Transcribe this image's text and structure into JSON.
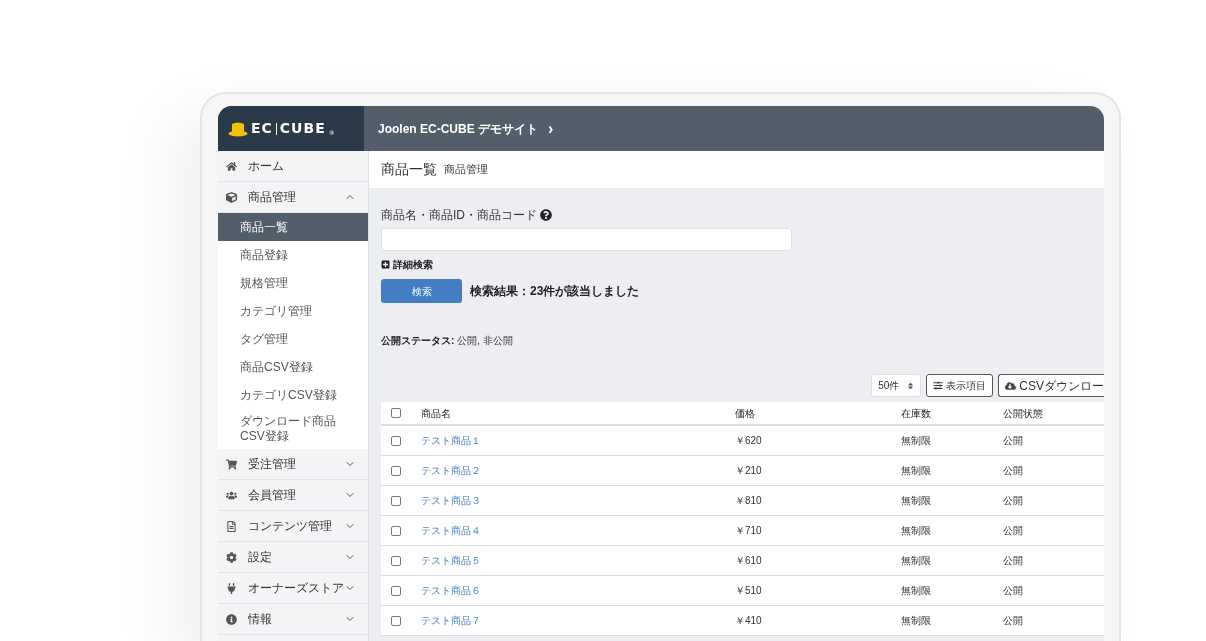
{
  "header": {
    "logo": {
      "left": "EC",
      "right": "CUBE",
      "mark": "®"
    },
    "site_title": "Joolen EC-CUBE デモサイト",
    "site_arrow": "›"
  },
  "sidebar": {
    "items": [
      {
        "label": "ホーム",
        "kind": "link"
      },
      {
        "label": "商品管理",
        "kind": "section",
        "expanded": true,
        "children": [
          {
            "label": "商品一覧",
            "selected": true
          },
          {
            "label": "商品登録",
            "selected": false
          },
          {
            "label": "規格管理",
            "selected": false
          },
          {
            "label": "カテゴリ管理",
            "selected": false
          },
          {
            "label": "タグ管理",
            "selected": false
          },
          {
            "label": "商品CSV登録",
            "selected": false
          },
          {
            "label": "カテゴリCSV登録",
            "selected": false
          },
          {
            "label": "ダウンロード商品CSV登録",
            "selected": false
          }
        ]
      },
      {
        "label": "受注管理",
        "kind": "section",
        "expanded": false
      },
      {
        "label": "会員管理",
        "kind": "section",
        "expanded": false
      },
      {
        "label": "コンテンツ管理",
        "kind": "section",
        "expanded": false
      },
      {
        "label": "設定",
        "kind": "section",
        "expanded": false
      },
      {
        "label": "オーナーズストア",
        "kind": "section",
        "expanded": false
      },
      {
        "label": "情報",
        "kind": "section",
        "expanded": false
      }
    ]
  },
  "page": {
    "title": "商品一覧",
    "subtitle": "商品管理"
  },
  "search": {
    "label": "商品名・商品ID・商品コード",
    "advanced": "詳細検索",
    "button": "検索",
    "result": "検索結果：23件が該当しました",
    "status_label": "公開ステータス:",
    "status_value": "公開, 非公開"
  },
  "toolbar": {
    "page_size": "50件",
    "columns_button": "表示項目",
    "csv_button": "CSVダウンロー"
  },
  "table": {
    "columns": [
      "商品名",
      "価格",
      "在庫数",
      "公開状態"
    ],
    "header_checked": false,
    "rows": [
      {
        "name": "テスト商品１",
        "price": "￥620",
        "stock": "無制限",
        "status": "公開",
        "checked": false
      },
      {
        "name": "テスト商品２",
        "price": "￥210",
        "stock": "無制限",
        "status": "公開",
        "checked": false
      },
      {
        "name": "テスト商品３",
        "price": "￥810",
        "stock": "無制限",
        "status": "公開",
        "checked": false
      },
      {
        "name": "テスト商品４",
        "price": "￥710",
        "stock": "無制限",
        "status": "公開",
        "checked": false
      },
      {
        "name": "テスト商品５",
        "price": "￥610",
        "stock": "無制限",
        "status": "公開",
        "checked": false
      },
      {
        "name": "テスト商品６",
        "price": "￥510",
        "stock": "無制限",
        "status": "公開",
        "checked": false
      },
      {
        "name": "テスト商品７",
        "price": "￥410",
        "stock": "無制限",
        "status": "公開",
        "checked": false
      }
    ]
  }
}
